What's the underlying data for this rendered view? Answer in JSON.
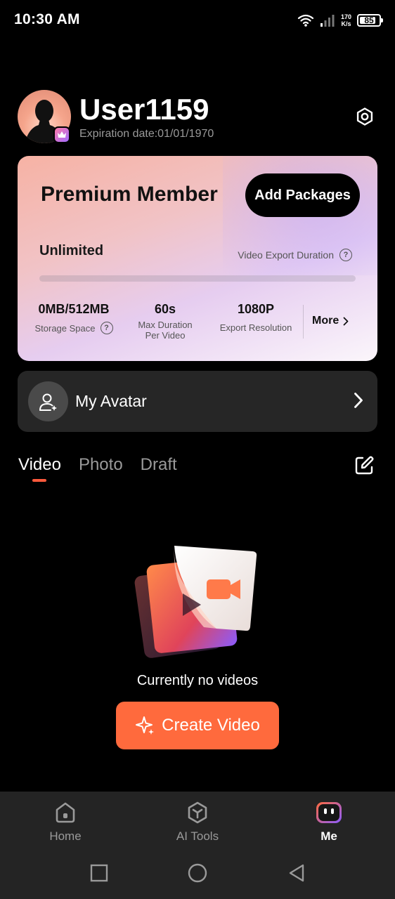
{
  "status_bar": {
    "time": "10:30 AM",
    "net_speed_value": "170",
    "net_speed_unit": "K/s",
    "battery_level": "85",
    "battery_fraction": 0.85
  },
  "profile": {
    "username": "User1159",
    "expiration": "Expiration date:01/01/1970",
    "avatar_icon": "user-silhouette",
    "badge_icon": "crown-icon",
    "settings_icon": "gear-icon"
  },
  "premium": {
    "title": "Premium Member",
    "add_packages_label": "Add Packages",
    "duration_value": "Unlimited",
    "duration_label": "Video Export Duration",
    "duration_progress": 0,
    "help_glyph": "?",
    "stats": [
      {
        "value": "0MB/512MB",
        "label": "Storage Space"
      },
      {
        "value": "60s",
        "label_line1": "Max Duration",
        "label_line2": "Per Video"
      },
      {
        "value": "1080P",
        "label": "Export Resolution"
      }
    ],
    "more_label": "More"
  },
  "my_avatar": {
    "label": "My Avatar"
  },
  "tabs": [
    {
      "label": "Video",
      "active": true
    },
    {
      "label": "Photo",
      "active": false
    },
    {
      "label": "Draft",
      "active": false
    }
  ],
  "empty_state": {
    "text": "Currently no videos",
    "button_label": "Create Video"
  },
  "bottom_nav": [
    {
      "label": "Home",
      "icon": "home-icon",
      "active": false
    },
    {
      "label": "AI Tools",
      "icon": "ai-tools-icon",
      "active": false
    },
    {
      "label": "Me",
      "icon": "robot-face-icon",
      "active": true
    }
  ],
  "colors": {
    "accent": "#ff6a3d",
    "tab_indicator": "#ff5a3c",
    "background": "#000000",
    "card_surface": "#262626"
  }
}
